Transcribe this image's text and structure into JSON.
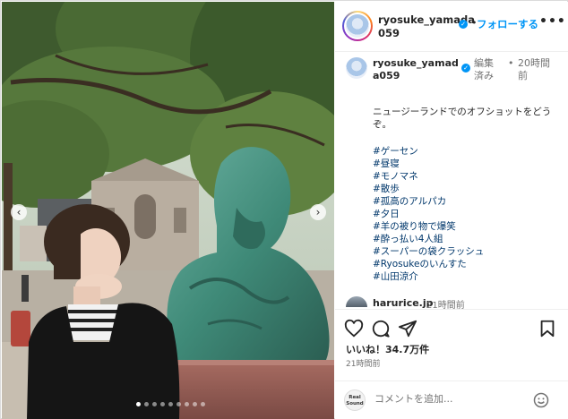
{
  "post": {
    "author": "ryosuke_yamada059",
    "follow_label": "フォローする",
    "more_label": "•••",
    "separator": "•"
  },
  "caption": {
    "username": "ryosuke_yamada059",
    "edited_label": "編集済み",
    "separator": "•",
    "time_ago": "20時間前",
    "text": "ニュージーランドでのオフショットをどうぞ。",
    "hashtags": [
      "#ゲーセン",
      "#昼寝",
      "#モノマネ",
      "#散歩",
      "#孤高のアルパカ",
      "#夕日",
      "#羊の被り物で爆笑",
      "#酔っ払い4人組",
      "#スーパーの袋クラッシュ",
      "#Ryosukeのいんすた",
      "#山田涼介"
    ]
  },
  "comment": {
    "username": "harurice.jp",
    "time_ago": "21時間前"
  },
  "engagement": {
    "likes": "いいね！34.7万件",
    "post_time": "21時間前"
  },
  "comment_input": {
    "placeholder": "コメントを追加...",
    "avatar_label": "Real Sound"
  },
  "carousel": {
    "slide_count": 9,
    "active_index": 0,
    "prev_label": "‹",
    "next_label": "›"
  },
  "icons": {
    "like": "heart-icon",
    "comment": "comment-bubble-icon",
    "share": "send-icon",
    "save": "bookmark-icon",
    "emoji": "smiley-icon",
    "verified": "verified-badge-icon"
  },
  "colors": {
    "follow": "#0095f6",
    "hashtag": "#00376b",
    "verified": "#0095f6",
    "muted_text": "#737373",
    "statue_bronze": "#4f9180"
  }
}
